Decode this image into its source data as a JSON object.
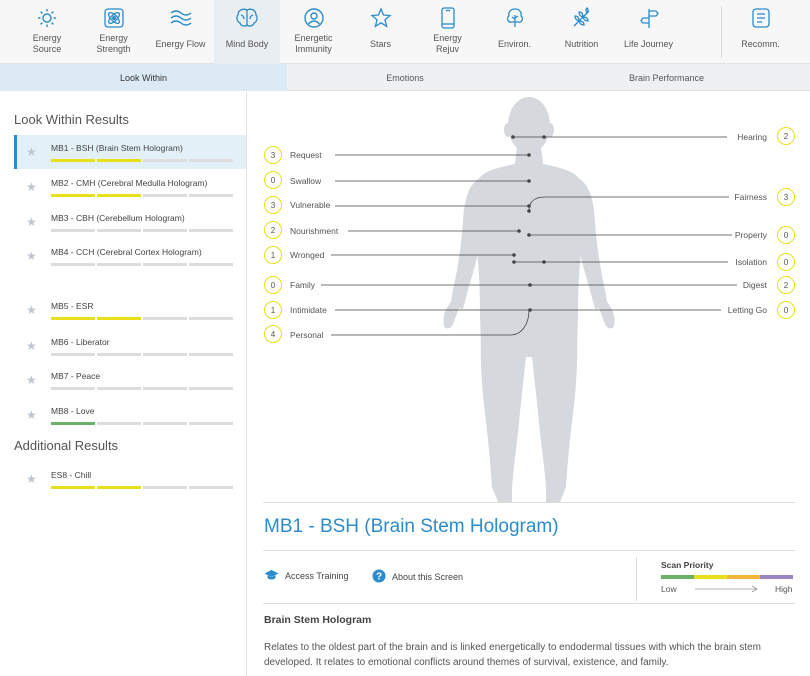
{
  "nav": {
    "items": [
      {
        "label": "Energy\nSource",
        "icon": "sun-icon"
      },
      {
        "label": "Energy\nStrength",
        "icon": "atom-icon"
      },
      {
        "label": "Energy Flow",
        "icon": "waves-icon"
      },
      {
        "label": "Mind Body",
        "icon": "brain-icon"
      },
      {
        "label": "Energetic\nImmunity",
        "icon": "person-circle-icon"
      },
      {
        "label": "Stars",
        "icon": "star-icon"
      },
      {
        "label": "Energy\nRejuv",
        "icon": "phone-icon"
      },
      {
        "label": "Environ.",
        "icon": "tree-icon"
      },
      {
        "label": "Nutrition",
        "icon": "wheat-icon"
      },
      {
        "label": "Life Journey",
        "icon": "signpost-icon"
      },
      {
        "label": "Recomm.",
        "icon": "list-icon"
      }
    ]
  },
  "subtabs": [
    "Look Within",
    "Emotions",
    "Brain Performance"
  ],
  "left": {
    "title": "Look Within Results",
    "results": [
      {
        "name": "MB1 - BSH (Brain Stem Hologram)",
        "bar": [
          "yellow",
          "yellow",
          "gray",
          "gray"
        ]
      },
      {
        "name": "MB2 - CMH (Cerebral Medulla Hologram)",
        "bar": [
          "yellow",
          "yellow",
          "gray",
          "gray"
        ]
      },
      {
        "name": "MB3 - CBH (Cerebellum Hologram)",
        "bar": [
          "gray",
          "gray",
          "gray",
          "gray"
        ]
      },
      {
        "name": "MB4 - CCH (Cerebral Cortex Hologram)",
        "bar": [
          "gray",
          "gray",
          "gray",
          "gray"
        ]
      },
      {
        "name": "MB5 - ESR",
        "bar": [
          "yellow",
          "yellow",
          "gray",
          "gray"
        ]
      },
      {
        "name": "MB6 - Liberator",
        "bar": [
          "gray",
          "gray",
          "gray",
          "gray"
        ]
      },
      {
        "name": "MB7 - Peace",
        "bar": [
          "gray",
          "gray",
          "gray",
          "gray"
        ]
      },
      {
        "name": "MB8 - Love",
        "bar": [
          "green",
          "gray",
          "gray",
          "gray"
        ]
      }
    ],
    "additional_title": "Additional Results",
    "additional": [
      {
        "name": "ES8 - Chill",
        "bar": [
          "yellow",
          "yellow",
          "gray",
          "gray"
        ]
      }
    ]
  },
  "body_labels_left": [
    {
      "num": "3",
      "label": "Request"
    },
    {
      "num": "0",
      "label": "Swallow"
    },
    {
      "num": "3",
      "label": "Vulnerable"
    },
    {
      "num": "2",
      "label": "Nourishment"
    },
    {
      "num": "1",
      "label": "Wronged"
    },
    {
      "num": "0",
      "label": "Family"
    },
    {
      "num": "1",
      "label": "Intimidate"
    },
    {
      "num": "4",
      "label": "Personal"
    }
  ],
  "body_labels_right": [
    {
      "num": "2",
      "label": "Hearing"
    },
    {
      "num": "3",
      "label": "Fairness"
    },
    {
      "num": "0",
      "label": "Property"
    },
    {
      "num": "0",
      "label": "Isolation"
    },
    {
      "num": "2",
      "label": "Digest"
    },
    {
      "num": "0",
      "label": "Letting Go"
    }
  ],
  "detail": {
    "title": "MB1 - BSH (Brain Stem Hologram)",
    "access_training": "Access Training",
    "about_screen": "About this Screen",
    "scan_priority": "Scan Priority",
    "low": "Low",
    "high": "High",
    "desc_title": "Brain Stem Hologram",
    "desc_text": "Relates to the oldest part of the brain and is linked energetically to endodermal tissues with which the brain stem developed. It relates to emotional conflicts around themes of survival, existence, and family."
  },
  "colors": {
    "accent": "#2b8ccd",
    "yellow": "#e8e01a",
    "green": "#6bb36b",
    "orange": "#f0b73a",
    "purple": "#9b84c4",
    "gray": "#dddddd"
  }
}
